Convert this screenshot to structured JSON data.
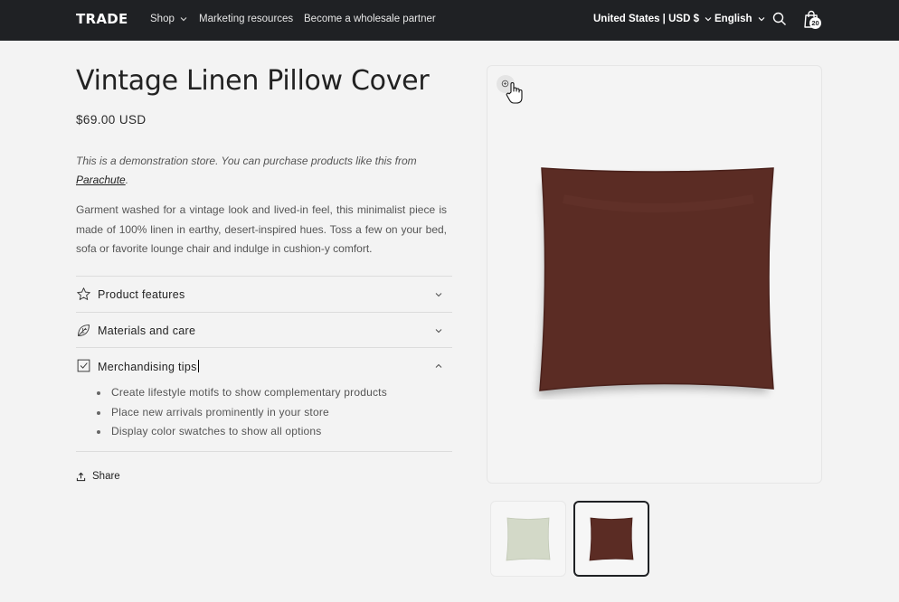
{
  "header": {
    "logo": "TRADE",
    "nav": {
      "shop": "Shop",
      "marketing": "Marketing resources",
      "wholesale": "Become a wholesale partner",
      "country": "United States | USD $",
      "language": "English"
    },
    "cart_count": "20"
  },
  "product": {
    "title": "Vintage Linen Pillow Cover",
    "price": "$69.00 USD",
    "demo_text": "This is a demonstration store. You can purchase products like this from",
    "demo_link": "Parachute",
    "description": "Garment washed for a vintage look and lived-in feel, this minimalist piece is made of 100% linen in earthy, desert-inspired hues. Toss a few on your bed, sofa or favorite lounge chair and indulge in cushion-y comfort.",
    "accordions": [
      {
        "label": "Product features",
        "icon": "star-icon",
        "expanded": false
      },
      {
        "label": "Materials and care",
        "icon": "leaf-icon",
        "expanded": false
      },
      {
        "label": "Merchandising tips",
        "icon": "checkbox-icon",
        "expanded": true
      }
    ],
    "tips": [
      "Create lifestyle motifs to show complementary products",
      "Place new arrivals prominently in your store",
      "Display color swatches to show all options"
    ],
    "share_label": "Share"
  },
  "media": {
    "colors": {
      "brown": "#5b2c24",
      "sage": "#d3d9c8",
      "header": "#1f2124"
    }
  }
}
